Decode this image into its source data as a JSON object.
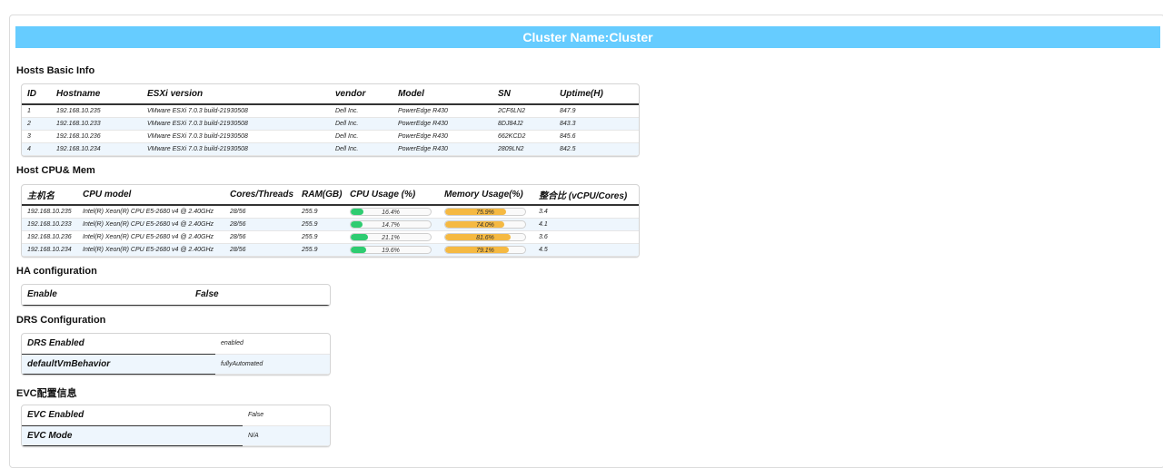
{
  "banner": {
    "title": "Cluster Name:Cluster"
  },
  "sections": {
    "hosts_basic": "Hosts Basic Info",
    "cpu_mem": "Host CPU& Mem",
    "ha": "HA configuration",
    "drs": "DRS Configuration",
    "evc": "EVC配置信息"
  },
  "hosts_basic": {
    "headers": [
      "ID",
      "Hostname",
      "ESXi version",
      "vendor",
      "Model",
      "SN",
      "Uptime(H)"
    ],
    "rows": [
      [
        "1",
        "192.168.10.235",
        "VMware ESXi 7.0.3 build-21930508",
        "Dell Inc.",
        "PowerEdge R430",
        "2CF6LN2",
        "847.9"
      ],
      [
        "2",
        "192.168.10.233",
        "VMware ESXi 7.0.3 build-21930508",
        "Dell Inc.",
        "PowerEdge R430",
        "8DJ84J2",
        "843.3"
      ],
      [
        "3",
        "192.168.10.236",
        "VMware ESXi 7.0.3 build-21930508",
        "Dell Inc.",
        "PowerEdge R430",
        "662KCD2",
        "845.6"
      ],
      [
        "4",
        "192.168.10.234",
        "VMware ESXi 7.0.3 build-21930508",
        "Dell Inc.",
        "PowerEdge R430",
        "2809LN2",
        "842.5"
      ]
    ]
  },
  "cpu_mem": {
    "headers": [
      "主机名",
      "CPU model",
      "Cores/Threads",
      "RAM(GB)",
      "CPU Usage  (%)",
      "Memory Usage(%)",
      "整合比  (vCPU/Cores)"
    ],
    "rows": [
      {
        "host": "192.168.10.235",
        "cpu_model": "Intel(R) Xeon(R) CPU E5-2680 v4 @ 2.40GHz",
        "cores": "28/56",
        "ram": "255.9",
        "cpu_usage": 16.4,
        "cpu_label": "16.4%",
        "mem_usage": 75.9,
        "mem_label": "75.9%",
        "ratio": "3.4"
      },
      {
        "host": "192.168.10.233",
        "cpu_model": "Intel(R) Xeon(R) CPU E5-2680 v4 @ 2.40GHz",
        "cores": "28/56",
        "ram": "255.9",
        "cpu_usage": 14.7,
        "cpu_label": "14.7%",
        "mem_usage": 74.0,
        "mem_label": "74.0%",
        "ratio": "4.1"
      },
      {
        "host": "192.168.10.236",
        "cpu_model": "Intel(R) Xeon(R) CPU E5-2680 v4 @ 2.40GHz",
        "cores": "28/56",
        "ram": "255.9",
        "cpu_usage": 21.1,
        "cpu_label": "21.1%",
        "mem_usage": 81.6,
        "mem_label": "81.6%",
        "ratio": "3.6"
      },
      {
        "host": "192.168.10.234",
        "cpu_model": "Intel(R) Xeon(R) CPU E5-2680 v4 @ 2.40GHz",
        "cores": "28/56",
        "ram": "255.9",
        "cpu_usage": 19.6,
        "cpu_label": "19.6%",
        "mem_usage": 79.1,
        "mem_label": "79.1%",
        "ratio": "4.5"
      }
    ]
  },
  "ha": {
    "key": "Enable",
    "value": "False"
  },
  "drs": {
    "rows": [
      {
        "key": "DRS Enabled",
        "value": "enabled"
      },
      {
        "key": "defaultVmBehavior",
        "value": "fullyAutomated"
      }
    ]
  },
  "evc": {
    "rows": [
      {
        "key": "EVC Enabled",
        "value": "False"
      },
      {
        "key": "EVC Mode",
        "value": "N/A"
      }
    ]
  },
  "colors": {
    "banner": "#66ccff",
    "cpu_bar": "#2ecc71",
    "mem_bar": "#f5b942",
    "row_alt": "#eef6fd"
  }
}
